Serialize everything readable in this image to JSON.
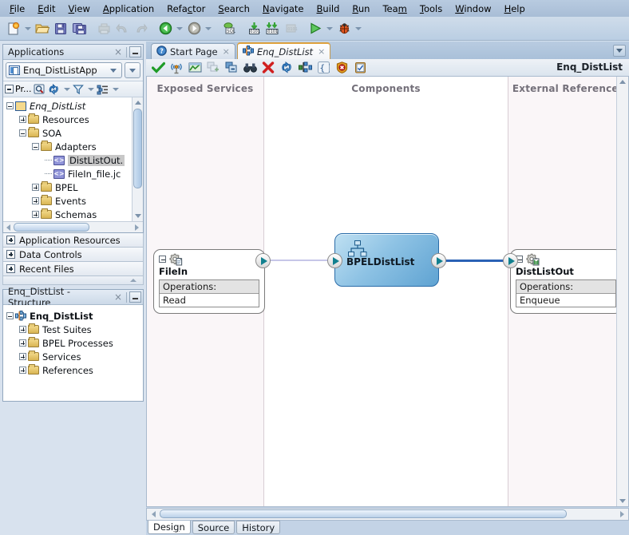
{
  "menubar": {
    "items": [
      {
        "label": "File",
        "mnemonic": "F"
      },
      {
        "label": "Edit",
        "mnemonic": "E"
      },
      {
        "label": "View",
        "mnemonic": "V"
      },
      {
        "label": "Application",
        "mnemonic": "A"
      },
      {
        "label": "Refactor",
        "mnemonic": "c"
      },
      {
        "label": "Search",
        "mnemonic": "S"
      },
      {
        "label": "Navigate",
        "mnemonic": "N"
      },
      {
        "label": "Build",
        "mnemonic": "B"
      },
      {
        "label": "Run",
        "mnemonic": "R"
      },
      {
        "label": "Team",
        "mnemonic": "m"
      },
      {
        "label": "Tools",
        "mnemonic": "T"
      },
      {
        "label": "Window",
        "mnemonic": "W"
      },
      {
        "label": "Help",
        "mnemonic": "H"
      }
    ]
  },
  "main_toolbar": {
    "buttons": [
      {
        "name": "new-file-icon",
        "label": "New"
      },
      {
        "name": "new-dropdown-arrow",
        "label": "New dropdown"
      },
      {
        "name": "open-folder-icon",
        "label": "Open"
      },
      {
        "name": "save-icon",
        "label": "Save"
      },
      {
        "name": "save-all-icon",
        "label": "Save All"
      },
      {
        "name": "print-icon",
        "label": "Print"
      },
      {
        "name": "undo-icon",
        "label": "Undo"
      },
      {
        "name": "redo-icon",
        "label": "Redo"
      },
      {
        "name": "back-icon",
        "label": "Back"
      },
      {
        "name": "back-dropdown-arrow",
        "label": "Back dropdown"
      },
      {
        "name": "forward-icon",
        "label": "Forward"
      },
      {
        "name": "forward-dropdown-arrow",
        "label": "Forward dropdown"
      },
      {
        "name": "sql-icon",
        "label": "SQL Worksheet"
      },
      {
        "name": "compile-icon",
        "label": "Make"
      },
      {
        "name": "rebuild-icon",
        "label": "Rebuild"
      },
      {
        "name": "clean-icon",
        "label": "Clean"
      },
      {
        "name": "run-icon",
        "label": "Run"
      },
      {
        "name": "run-dropdown-arrow",
        "label": "Run dropdown"
      },
      {
        "name": "debug-icon",
        "label": "Debug"
      },
      {
        "name": "debug-dropdown-arrow",
        "label": "Debug dropdown"
      }
    ]
  },
  "applications_panel": {
    "title": "Applications",
    "close_label": "×",
    "application_name": "Enq_DistListApp",
    "project_filter_label": "Pr...",
    "toolbar_icons": [
      {
        "name": "search-icon"
      },
      {
        "name": "refresh-icon"
      },
      {
        "name": "filter-icon"
      },
      {
        "name": "view-options-icon"
      }
    ],
    "tree": [
      {
        "label": "Enq_DistList",
        "depth": 0,
        "expander": "minus",
        "icon": "project-icon",
        "italic": true,
        "selected": false
      },
      {
        "label": "Resources",
        "depth": 1,
        "expander": "plus",
        "icon": "folder-icon",
        "italic": false,
        "selected": false
      },
      {
        "label": "SOA",
        "depth": 1,
        "expander": "minus",
        "icon": "folder-icon",
        "italic": false,
        "selected": false
      },
      {
        "label": "Adapters",
        "depth": 2,
        "expander": "minus",
        "icon": "folder-icon",
        "italic": false,
        "selected": false
      },
      {
        "label": "DistListOut.",
        "depth": 3,
        "expander": "none",
        "icon": "xml-file-icon",
        "italic": false,
        "selected": true
      },
      {
        "label": "FileIn_file.jc",
        "depth": 3,
        "expander": "none",
        "icon": "xml-file-icon",
        "italic": false,
        "selected": false
      },
      {
        "label": "BPEL",
        "depth": 2,
        "expander": "plus",
        "icon": "folder-icon",
        "italic": false,
        "selected": false
      },
      {
        "label": "Events",
        "depth": 2,
        "expander": "plus",
        "icon": "folder-icon",
        "italic": false,
        "selected": false
      },
      {
        "label": "Schemas",
        "depth": 2,
        "expander": "plus",
        "icon": "folder-icon",
        "italic": false,
        "selected": false
      }
    ]
  },
  "collapsed_panels": [
    {
      "label": "Application Resources"
    },
    {
      "label": "Data Controls"
    },
    {
      "label": "Recent Files"
    }
  ],
  "structure_panel": {
    "title": "Enq_DistList - Structure",
    "close_label": "×",
    "tree": [
      {
        "label": "Enq_DistList",
        "depth": 0,
        "expander": "minus",
        "icon": "composite-icon",
        "bold": true
      },
      {
        "label": "Test Suites",
        "depth": 1,
        "expander": "plus",
        "icon": "folder-icon",
        "bold": false
      },
      {
        "label": "BPEL Processes",
        "depth": 1,
        "expander": "plus",
        "icon": "folder-icon",
        "bold": false
      },
      {
        "label": "Services",
        "depth": 1,
        "expander": "plus",
        "icon": "folder-icon",
        "bold": false
      },
      {
        "label": "References",
        "depth": 1,
        "expander": "plus",
        "icon": "folder-icon",
        "bold": false
      }
    ]
  },
  "editor": {
    "tabs": [
      {
        "label": "Start Page",
        "active": false,
        "icon": "help-circle-icon",
        "close_label": "×"
      },
      {
        "label": "Enq_DistList",
        "active": true,
        "icon": "composite-icon",
        "close_label": "×"
      }
    ],
    "toolbar_title": "Enq_DistList",
    "toolbar_icons": [
      {
        "name": "validate-check-icon"
      },
      {
        "name": "wsdl-antenna-icon"
      },
      {
        "name": "monitor-chart-icon"
      },
      {
        "name": "add-component-icon"
      },
      {
        "name": "remove-component-icon"
      },
      {
        "name": "find-binoculars-icon"
      },
      {
        "name": "delete-x-icon"
      },
      {
        "name": "refresh-arrows-icon"
      },
      {
        "name": "composite-structure-icon"
      },
      {
        "name": "braces-icon"
      },
      {
        "name": "security-shield-icon"
      },
      {
        "name": "clipboard-policy-icon"
      }
    ],
    "lanes": [
      {
        "name": "exposed-services",
        "title": "Exposed Services"
      },
      {
        "name": "components",
        "title": "Components"
      },
      {
        "name": "external-references",
        "title": "External References"
      }
    ],
    "nodes": {
      "exposed_service": {
        "name": "FileIn",
        "operations_header": "Operations:",
        "operations": [
          "Read"
        ],
        "icon": "file-adapter-icon"
      },
      "component": {
        "name": "BPELDistList",
        "icon": "bpel-process-icon",
        "fill_color": "#8dc2e4",
        "border_color": "#2a6ca8"
      },
      "external_reference": {
        "name": "DistListOut",
        "operations_header": "Operations:",
        "operations": [
          "Enqueue"
        ],
        "icon": "aq-adapter-icon"
      }
    },
    "wires": [
      {
        "name": "filein-to-bpel",
        "color": "#c6c6e8",
        "selected": false
      },
      {
        "name": "bpel-to-distlistout",
        "color": "#2a62b5",
        "selected": true
      }
    ],
    "bottom_tabs": [
      {
        "label": "Design",
        "active": true,
        "mnemonic": "g"
      },
      {
        "label": "Source",
        "active": false,
        "mnemonic": ""
      },
      {
        "label": "History",
        "active": false,
        "mnemonic": ""
      }
    ]
  }
}
